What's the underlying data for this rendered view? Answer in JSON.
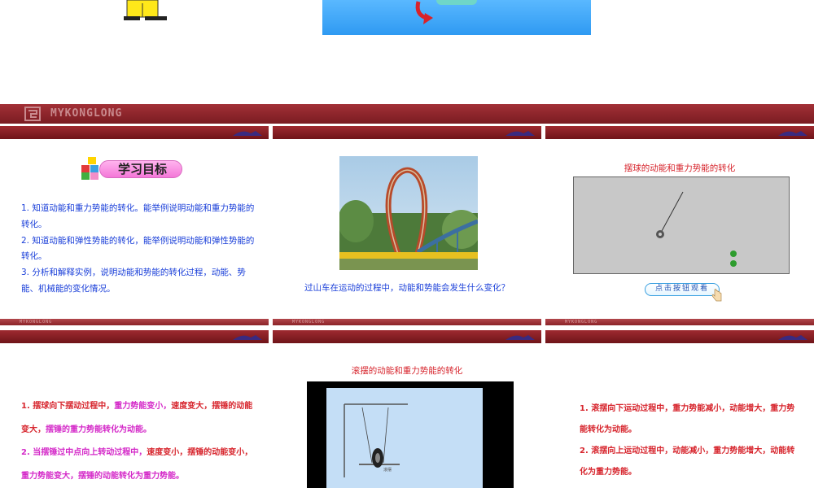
{
  "brand": {
    "name": "MYKONGLONG",
    "footer_brand": "MYKONGLONG"
  },
  "colors": {
    "band": "#8b2328",
    "title_red": "#d7262e",
    "text_blue": "#1a3fd9",
    "text_pink": "#d429c8"
  },
  "slides": [
    {
      "badge": "学习目标",
      "lines": [
        "1. 知道动能和重力势能的转化。能举例说明动能和重力势能的转化。",
        "2. 知道动能和弹性势能的转化，能举例说明动能和弹性势能的转化。",
        "3. 分析和解释实例，说明动能和势能的转化过程，动能、势能、机械能的变化情况。"
      ]
    },
    {
      "caption": "过山车在运动的过程中，动能和势能会发生什么变化？"
    },
    {
      "title": "摆球的动能和重力势能的转化",
      "button": "点击按钮观看"
    },
    {
      "p1_a": "1. 摆球向下摆动过程中，",
      "p1_b": "重力势能变小，",
      "p1_c": "速度变大，摆锤的动能变大，",
      "p1_d": "摆锤的重力势能转化为动能。",
      "p2_a": "2. 当摆锤过中点向上转动过程中，",
      "p2_b": "速度变小，摆锤的动能变小，",
      "p2_c": "重力势能变大，",
      "p2_d": "摆锤的动能转化为重力势能。"
    },
    {
      "title": "滚摆的动能和重力势能的转化",
      "label": "滚摆"
    },
    {
      "lines": [
        "1. 滚摆向下运动过程中，重力势能减小，动能增大，重力势能转化为动能。",
        "2. 滚摆向上运动过程中，动能减小，重力势能增大，动能转化为重力势能。"
      ]
    }
  ]
}
